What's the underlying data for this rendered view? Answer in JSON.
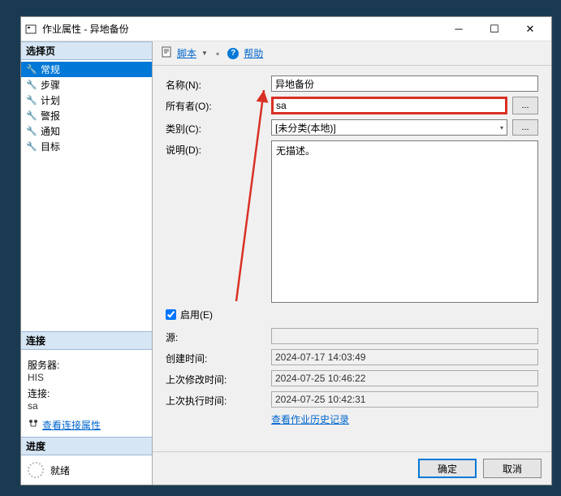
{
  "window": {
    "title": "作业属性 - 异地备份"
  },
  "left": {
    "select_header": "选择页",
    "nav": [
      "常规",
      "步骤",
      "计划",
      "警报",
      "通知",
      "目标"
    ],
    "conn_header": "连接",
    "server_label": "服务器:",
    "server_value": "HIS",
    "connection_label": "连接:",
    "connection_value": "sa",
    "view_conn_props": "查看连接属性",
    "progress_header": "进度",
    "progress_status": "就绪"
  },
  "toolbar": {
    "script": "脚本",
    "help": "帮助"
  },
  "form": {
    "name_label": "名称(N):",
    "name_value": "异地备份",
    "owner_label": "所有者(O):",
    "owner_value": "sa",
    "browse": "...",
    "category_label": "类别(C):",
    "category_value": "[未分类(本地)]",
    "desc_label": "说明(D):",
    "desc_value": "无描述。",
    "enable_label": "启用(E)",
    "source_label": "源:",
    "source_value": "",
    "created_label": "创建时间:",
    "created_value": "2024-07-17 14:03:49",
    "modified_label": "上次修改时间:",
    "modified_value": "2024-07-25 10:46:22",
    "executed_label": "上次执行时间:",
    "executed_value": "2024-07-25 10:42:31",
    "history_link": "查看作业历史记录"
  },
  "footer": {
    "ok": "确定",
    "cancel": "取消"
  }
}
